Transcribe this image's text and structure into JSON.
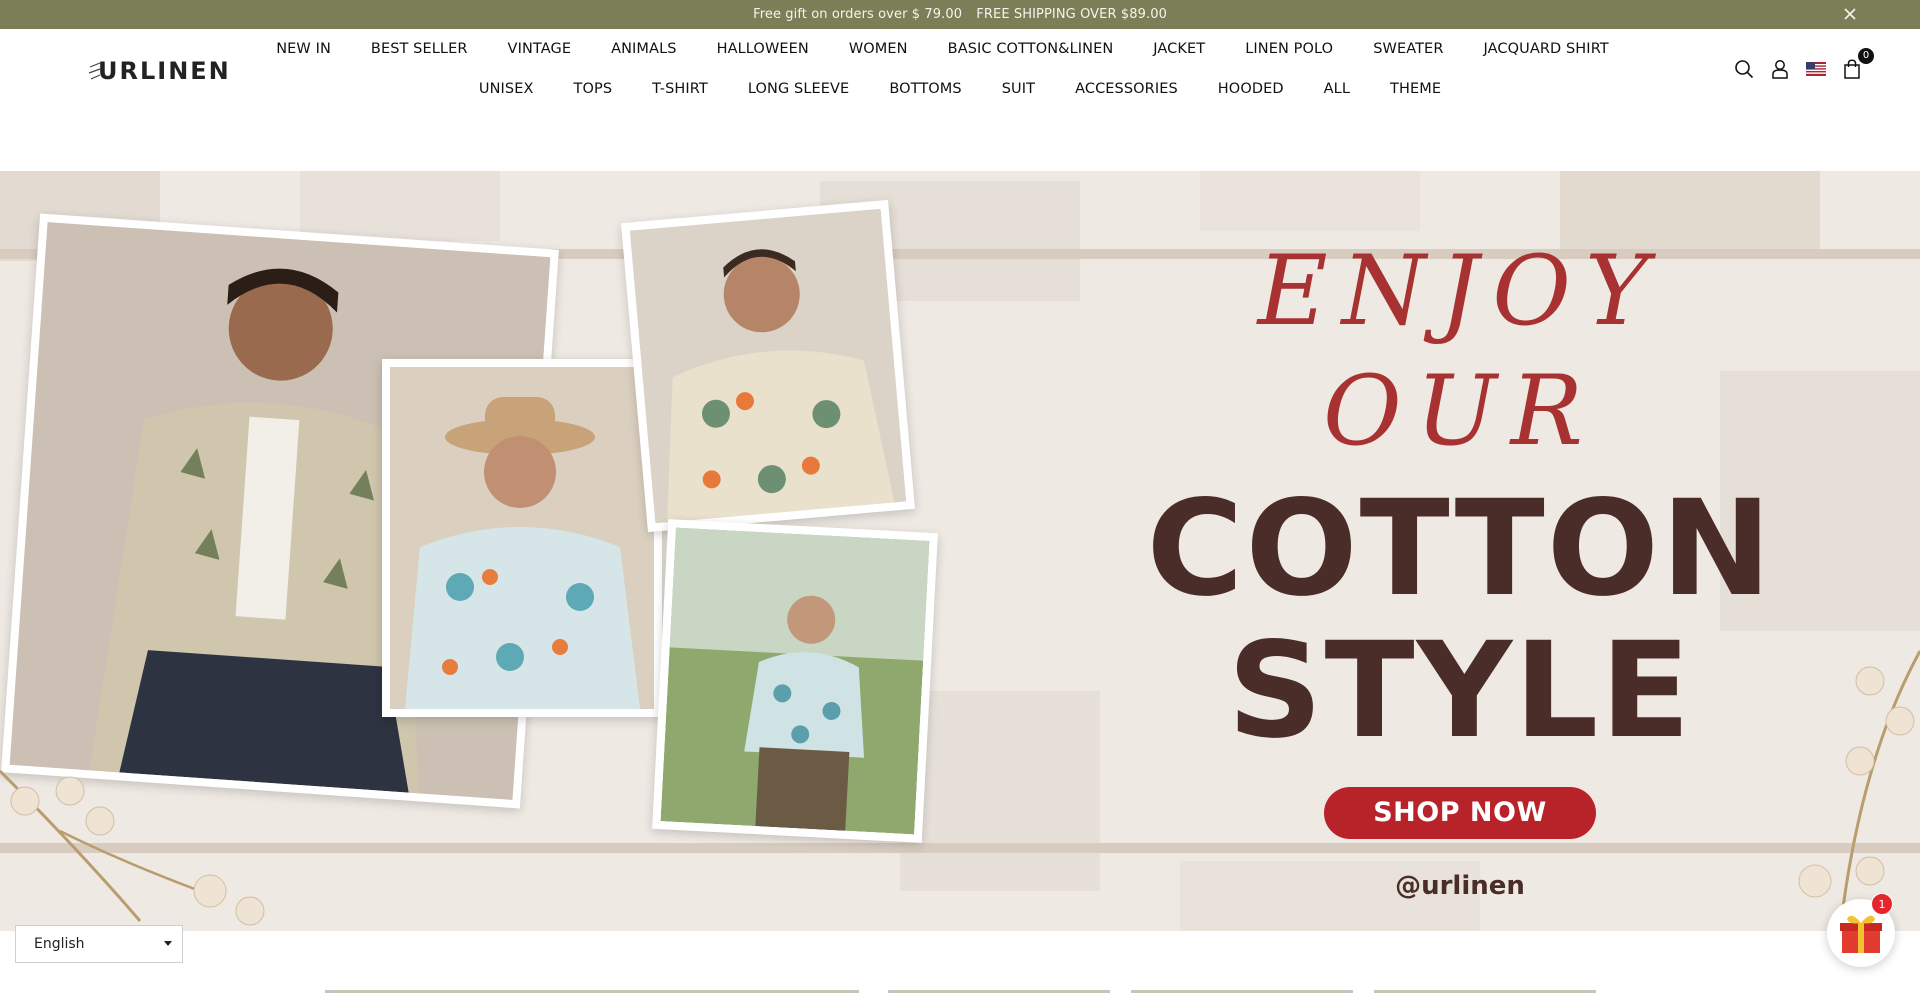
{
  "announcement": {
    "text_1": "Free gift on orders over $ 79.00",
    "text_2": "FREE SHIPPING OVER $89.00"
  },
  "header": {
    "logo_text": "URLINEN",
    "nav_row_1": [
      "NEW IN",
      "BEST SELLER",
      "VINTAGE",
      "ANIMALS",
      "HALLOWEEN",
      "WOMEN",
      "BASIC COTTON&LINEN",
      "JACKET",
      "LINEN POLO",
      "SWEATER",
      "JACQUARD SHIRT"
    ],
    "nav_row_2": [
      "UNISEX",
      "TOPS",
      "T-SHIRT",
      "LONG SLEEVE",
      "BOTTOMS",
      "SUIT",
      "ACCESSORIES",
      "HOODED",
      "ALL",
      "THEME"
    ],
    "icons": [
      "search-icon",
      "account-icon",
      "us-flag-icon",
      "cart-icon"
    ],
    "cart_count": "0"
  },
  "hero": {
    "headline_script": "ENJOY OUR",
    "headline_line_1": "COTTON",
    "headline_line_2": "STYLE",
    "cta_label": "SHOP NOW",
    "handle": "@urlinen",
    "colors": {
      "script": "#a83232",
      "headline": "#4a2c28",
      "cta": "#b8232a"
    }
  },
  "language_selector": {
    "value": "English"
  },
  "gift_widget": {
    "badge_count": "1",
    "icon": "gift-icon"
  },
  "theme": {
    "announcement_bg": "#7a7f57"
  }
}
